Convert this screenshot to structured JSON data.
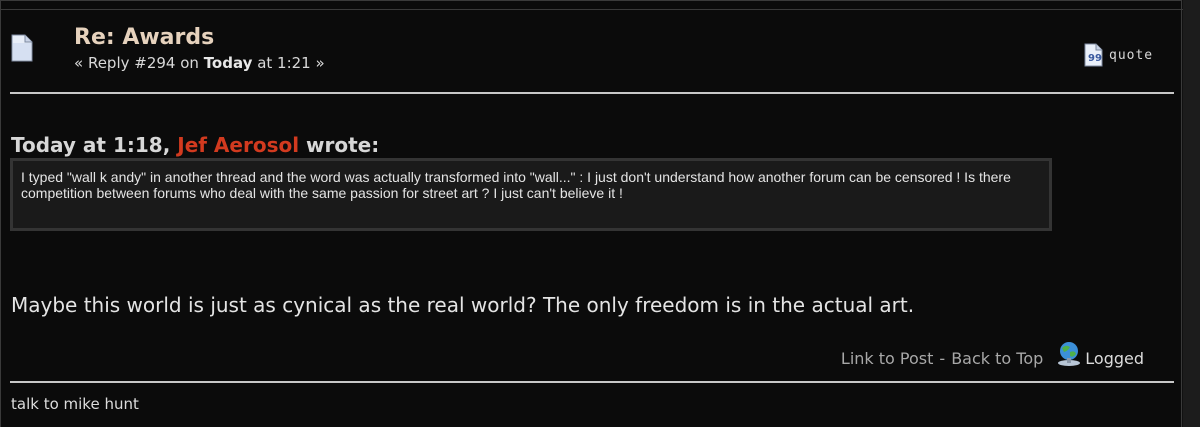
{
  "post": {
    "subject": "Re: Awards",
    "meta_prefix": "« Reply #294 on ",
    "meta_day": "Today",
    "meta_suffix": " at 1:21 »",
    "quote_label": "quote"
  },
  "quote": {
    "timestamp": "Today at 1:18, ",
    "author": "Jef Aerosol",
    "wrote": " wrote:",
    "text": "I typed \"wall k andy\" in another thread and the word was actually transformed into \"wall...\" : I just don't understand how another forum can be censored ! Is there competition between forums who deal with the same passion for street art ? I just can't believe it !"
  },
  "body": {
    "text": "Maybe this world is just as cynical as the real world? The only freedom is in the actual art."
  },
  "footer": {
    "link_to_post": "Link to Post",
    "separator": "-",
    "back_to_top": "Back to Top",
    "logged": "Logged"
  },
  "signature": {
    "text": "talk to mike hunt"
  },
  "icons": {
    "post": "document-icon",
    "quote": "quote-icon",
    "logged": "globe-network-icon"
  },
  "colors": {
    "background": "#0b0b0b",
    "subject": "#e6d2bd",
    "author": "#d23a1f",
    "quote_box": "#1a1a1a"
  }
}
